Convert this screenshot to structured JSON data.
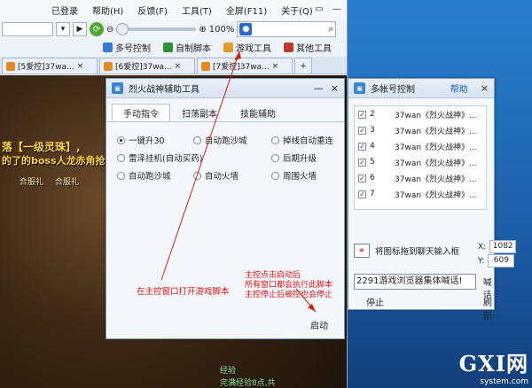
{
  "browser": {
    "menu": [
      "已登录",
      "帮助(H)",
      "反馈(F)",
      "工具(T)",
      "全屏(F11)",
      "关于(Q)"
    ],
    "zoom_label": "100%",
    "toolbar": [
      {
        "label": "多号控制",
        "icon": "multi-account-icon",
        "color": "#3a7bd5"
      },
      {
        "label": "自制脚本",
        "icon": "script-icon",
        "color": "#2f8f3a"
      },
      {
        "label": "游戏工具",
        "icon": "game-tool-icon",
        "color": "#e39b2a"
      },
      {
        "label": "其他工具",
        "icon": "other-tools-icon",
        "color": "#c0392b"
      }
    ],
    "tabs": [
      "[5爱控]37wa...",
      "[6爱控]37wa...",
      "[7爱控]37wa..."
    ]
  },
  "game": {
    "texts": [
      "落【一级灵珠】,",
      "的了的boss人龙赤角抢",
      "合服礼",
      "合服礼"
    ],
    "bottom_text": "经验",
    "bottom_text2": "完满经验8点,共"
  },
  "dialog": {
    "title": "烈火战神辅助工具",
    "tabs": [
      "手动指令",
      "扫荡副本",
      "技能辅助"
    ],
    "options": [
      {
        "label": "一键升30",
        "on": true
      },
      {
        "label": "自动跑沙城",
        "on": false
      },
      {
        "label": "掉线自动重连",
        "on": false
      },
      {
        "label": "雷泽挂机(自动买药)",
        "on": false
      },
      {
        "label": "",
        "on": false
      },
      {
        "label": "后期升级",
        "on": false
      },
      {
        "label": "自动跑沙城",
        "on": false
      },
      {
        "label": "自动火墙",
        "on": false
      },
      {
        "label": "周围火墙",
        "on": false
      }
    ],
    "annotation_left": "在主控窗口打开游戏脚本",
    "annotation_right": [
      "主控点击启动后",
      "所有窗口都会执行此脚本",
      "主控停止后被控也会停止"
    ],
    "start_label": "启动"
  },
  "panel": {
    "title": "多帐号控制",
    "help_label": "帮助",
    "accounts": [
      {
        "num": "2",
        "name": "37wan《烈火战神》..."
      },
      {
        "num": "3",
        "name": "37wan《烈火战神》..."
      },
      {
        "num": "4",
        "name": "37wan《烈火战神》..."
      },
      {
        "num": "5",
        "name": "37wan《烈火战神》..."
      },
      {
        "num": "6",
        "name": "37wan《烈火战神》..."
      },
      {
        "num": "7",
        "name": "37wan《烈火战神》..."
      }
    ],
    "drag_label": "将图标拖到聊天输入框",
    "x_label": "X:",
    "x_value": "1082",
    "y_label": "Y:",
    "y_value": "609",
    "message": "2291游戏浏览器集体喊话!",
    "shout_label": "喊话",
    "stop_label": "停止",
    "refresh_label": "刷新"
  },
  "logo": {
    "big": "GXI网",
    "small": "system.com"
  }
}
